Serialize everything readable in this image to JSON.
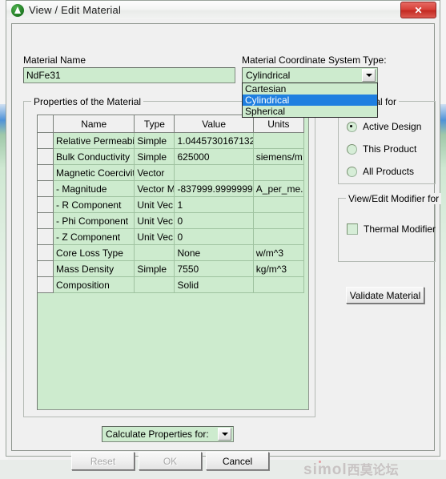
{
  "window": {
    "title": "View / Edit Material",
    "app_icon": "ansys-green-icon",
    "close_label": "✕"
  },
  "form": {
    "material_name_label": "Material Name",
    "material_name_value": "NdFe31",
    "material_name_placeholder": "",
    "coord_type_label": "Material Coordinate System Type:",
    "coord_type_value": "Cylindrical",
    "coord_type_options": [
      "Cartesian",
      "Cylindrical",
      "Spherical"
    ],
    "coord_type_selected_index": 1
  },
  "properties_group": {
    "title": "Properties of the Material",
    "columns": [
      "",
      "Name",
      "Type",
      "Value",
      "Units"
    ],
    "rows": [
      {
        "name": "Relative Permeabi...",
        "type": "Simple",
        "value": "1.0445730167132",
        "units": "",
        "indent": false
      },
      {
        "name": "Bulk Conductivity",
        "type": "Simple",
        "value": "625000",
        "units": "siemens/m",
        "indent": false
      },
      {
        "name": "Magnetic Coercivity",
        "type": "Vector",
        "value": "",
        "units": "",
        "indent": false
      },
      {
        "name": "-  Magnitude",
        "type": "Vector M...",
        "value": "-837999.9999999...",
        "units": "A_per_me...",
        "indent": true
      },
      {
        "name": "-  R Component",
        "type": "Unit Vec...",
        "value": "1",
        "units": "",
        "indent": true
      },
      {
        "name": "-  Phi Component",
        "type": "Unit Vec...",
        "value": "0",
        "units": "",
        "indent": true
      },
      {
        "name": "-  Z Component",
        "type": "Unit Vec...",
        "value": "0",
        "units": "",
        "indent": true
      },
      {
        "name": "Core Loss Type",
        "type": "",
        "value": "None",
        "units": "w/m^3",
        "indent": false
      },
      {
        "name": "Mass Density",
        "type": "Simple",
        "value": "7550",
        "units": "kg/m^3",
        "indent": false
      },
      {
        "name": "Composition",
        "type": "",
        "value": "Solid",
        "units": "",
        "indent": false
      }
    ]
  },
  "material_for_group": {
    "title": "Material for",
    "options": [
      {
        "label": "Active Design",
        "checked": true
      },
      {
        "label": "This Product",
        "checked": false
      },
      {
        "label": "All Products",
        "checked": false
      }
    ]
  },
  "modifier_group": {
    "title": "View/Edit Modifier for",
    "checkbox_label": "Thermal Modifier",
    "checkbox_checked": false
  },
  "actions": {
    "validate_label": "Validate Material",
    "calculate_label": "Calculate Properties for:",
    "reset_label": "Reset",
    "ok_label": "OK",
    "cancel_label": "Cancel",
    "reset_enabled": false,
    "ok_enabled": false,
    "cancel_enabled": true
  },
  "watermark": {
    "latin": "simol",
    "cjk": "西莫论坛"
  },
  "colors": {
    "field_green": "#cdebce",
    "dialog_face": "#f0f0f0",
    "selection_blue": "#1f7fe0",
    "close_red": "#c32a22",
    "accent_icon_green": "#1f7a22"
  }
}
